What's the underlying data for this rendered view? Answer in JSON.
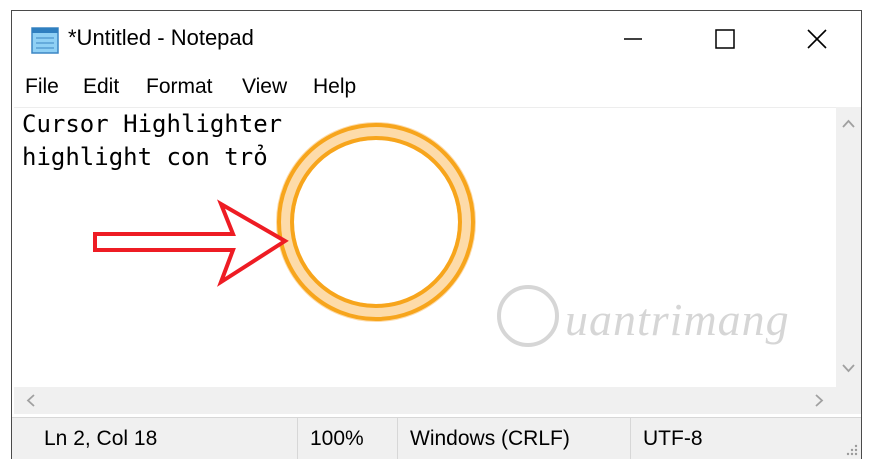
{
  "window": {
    "title": "*Untitled - Notepad",
    "icons": {
      "app": "notepad-icon",
      "minimize": "minimize-icon",
      "maximize": "maximize-icon",
      "close": "close-icon"
    }
  },
  "menu": {
    "items": [
      "File",
      "Edit",
      "Format",
      "View",
      "Help"
    ]
  },
  "editor": {
    "lines": [
      "Cursor Highlighter",
      "highlight con trỏ"
    ]
  },
  "statusbar": {
    "position": "Ln 2, Col 18",
    "zoom": "100%",
    "line_ending": "Windows (CRLF)",
    "encoding": "UTF-8"
  },
  "overlay": {
    "highlight_color": "#f7a51c",
    "arrow_color": "#ee1c24",
    "watermark": "uantrimang"
  }
}
